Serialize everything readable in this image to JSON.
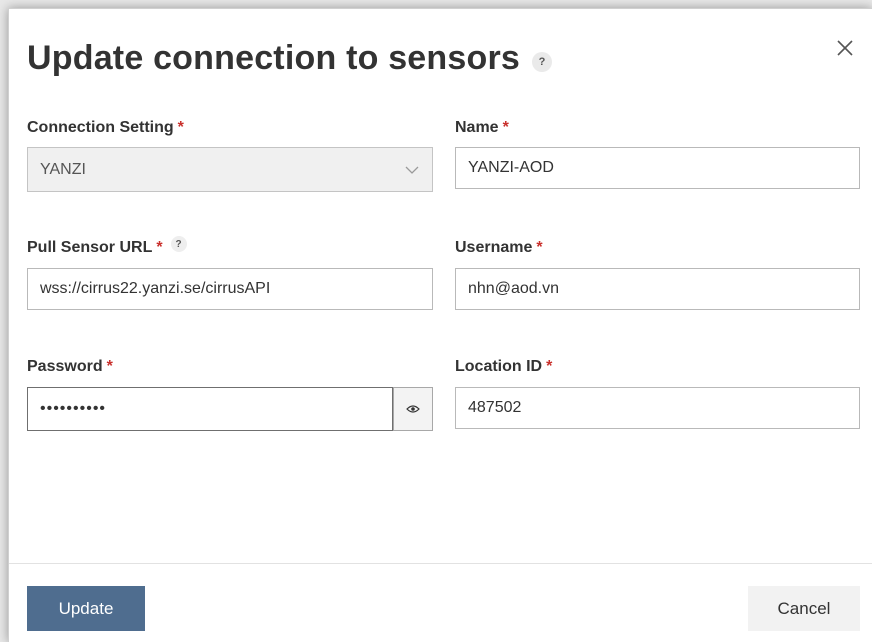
{
  "dialog": {
    "title": "Update connection to sensors",
    "help_glyph": "?",
    "close_glyph": "×"
  },
  "fields": {
    "connection_setting": {
      "label": "Connection Setting",
      "required_mark": "*",
      "value": "YANZI"
    },
    "name": {
      "label": "Name",
      "required_mark": "*",
      "value": "YANZI-AOD"
    },
    "pull_sensor_url": {
      "label": "Pull Sensor URL",
      "required_mark": "*",
      "help_glyph": "?",
      "value": "wss://cirrus22.yanzi.se/cirrusAPI"
    },
    "username": {
      "label": "Username",
      "required_mark": "*",
      "value": "nhn@aod.vn"
    },
    "password": {
      "label": "Password",
      "required_mark": "*",
      "value": "••••••••••"
    },
    "location_id": {
      "label": "Location ID",
      "required_mark": "*",
      "value": "487502"
    }
  },
  "footer": {
    "update_label": "Update",
    "cancel_label": "Cancel"
  },
  "colors": {
    "primary": "#4f6d8f",
    "required": "#c9302c",
    "text": "#333333"
  },
  "icons": {
    "close": "close-icon",
    "help": "help-icon",
    "chevron": "chevron-down-icon",
    "eye": "eye-icon"
  }
}
